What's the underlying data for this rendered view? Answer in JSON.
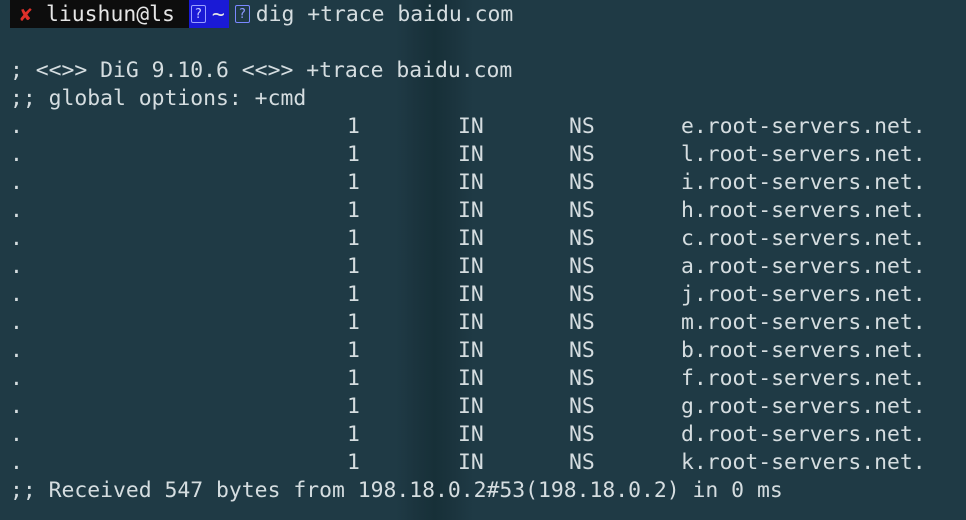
{
  "prompt": {
    "status_icon": "✘",
    "user_host": "liushun@ls",
    "dir_glyph": "?",
    "dir": "~",
    "arrow_glyph": "?",
    "command": "dig +trace baidu.com"
  },
  "output": {
    "header": "; <<>> DiG 9.10.6 <<>> +trace baidu.com",
    "options": ";; global options: +cmd",
    "records": [
      {
        "name": ".",
        "ttl": "1",
        "class": "IN",
        "type": "NS",
        "data": "e.root-servers.net."
      },
      {
        "name": ".",
        "ttl": "1",
        "class": "IN",
        "type": "NS",
        "data": "l.root-servers.net."
      },
      {
        "name": ".",
        "ttl": "1",
        "class": "IN",
        "type": "NS",
        "data": "i.root-servers.net."
      },
      {
        "name": ".",
        "ttl": "1",
        "class": "IN",
        "type": "NS",
        "data": "h.root-servers.net."
      },
      {
        "name": ".",
        "ttl": "1",
        "class": "IN",
        "type": "NS",
        "data": "c.root-servers.net."
      },
      {
        "name": ".",
        "ttl": "1",
        "class": "IN",
        "type": "NS",
        "data": "a.root-servers.net."
      },
      {
        "name": ".",
        "ttl": "1",
        "class": "IN",
        "type": "NS",
        "data": "j.root-servers.net."
      },
      {
        "name": ".",
        "ttl": "1",
        "class": "IN",
        "type": "NS",
        "data": "m.root-servers.net."
      },
      {
        "name": ".",
        "ttl": "1",
        "class": "IN",
        "type": "NS",
        "data": "b.root-servers.net."
      },
      {
        "name": ".",
        "ttl": "1",
        "class": "IN",
        "type": "NS",
        "data": "f.root-servers.net."
      },
      {
        "name": ".",
        "ttl": "1",
        "class": "IN",
        "type": "NS",
        "data": "g.root-servers.net."
      },
      {
        "name": ".",
        "ttl": "1",
        "class": "IN",
        "type": "NS",
        "data": "d.root-servers.net."
      },
      {
        "name": ".",
        "ttl": "1",
        "class": "IN",
        "type": "NS",
        "data": "k.root-servers.net."
      }
    ],
    "footer": ";; Received 547 bytes from 198.18.0.2#53(198.18.0.2) in 0 ms"
  },
  "colors": {
    "background": "#1f3a45",
    "text": "#d5dde0",
    "error_icon": "#e0302a",
    "dir_segment": "#1a1ad6",
    "user_segment": "#0d0d0d"
  }
}
